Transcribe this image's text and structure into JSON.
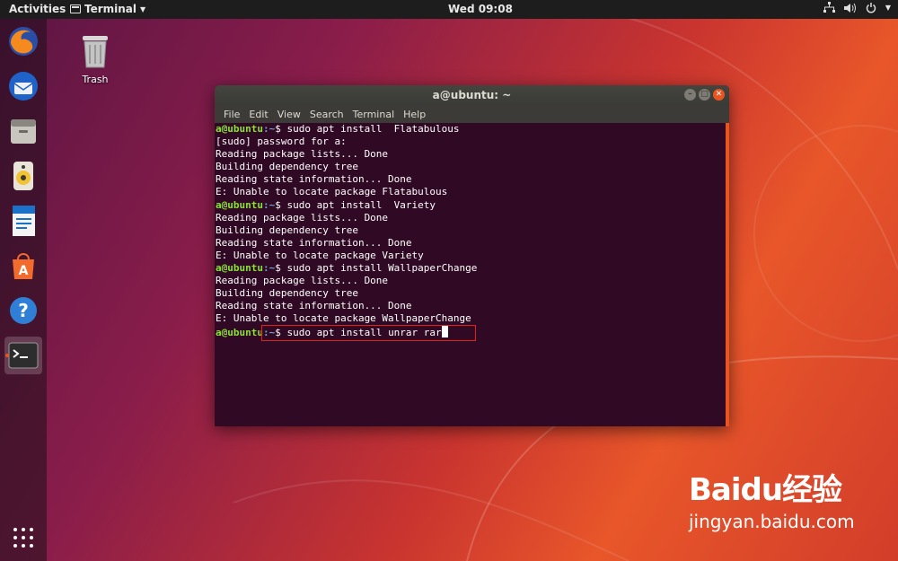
{
  "topbar": {
    "activities": "Activities",
    "app_name": "Terminal",
    "clock": "Wed 09:08"
  },
  "dock": {
    "items": [
      "firefox-icon",
      "thunderbird-icon",
      "files-icon",
      "rhythmbox-icon",
      "writer-icon",
      "software-center-icon",
      "help-icon",
      "terminal-icon"
    ]
  },
  "desktop": {
    "trash_label": "Trash"
  },
  "terminal": {
    "title": "a@ubuntu: ~",
    "menu": [
      "File",
      "Edit",
      "View",
      "Search",
      "Terminal",
      "Help"
    ],
    "prompt_user": "a@ubuntu",
    "prompt_path": ":~",
    "lines": [
      {
        "type": "prompt",
        "cmd": "$ sudo apt install  Flatabulous"
      },
      {
        "type": "out",
        "text": "[sudo] password for a:"
      },
      {
        "type": "out",
        "text": "Reading package lists... Done"
      },
      {
        "type": "out",
        "text": "Building dependency tree"
      },
      {
        "type": "out",
        "text": "Reading state information... Done"
      },
      {
        "type": "out",
        "text": "E: Unable to locate package Flatabulous"
      },
      {
        "type": "prompt",
        "cmd": "$ sudo apt install  Variety"
      },
      {
        "type": "out",
        "text": "Reading package lists... Done"
      },
      {
        "type": "out",
        "text": "Building dependency tree"
      },
      {
        "type": "out",
        "text": "Reading state information... Done"
      },
      {
        "type": "out",
        "text": "E: Unable to locate package Variety"
      },
      {
        "type": "prompt",
        "cmd": "$ sudo apt install WallpaperChange"
      },
      {
        "type": "out",
        "text": "Reading package lists... Done"
      },
      {
        "type": "out",
        "text": "Building dependency tree"
      },
      {
        "type": "out",
        "text": "Reading state information... Done"
      },
      {
        "type": "out",
        "text": "E: Unable to locate package WallpaperChange"
      },
      {
        "type": "prompt",
        "cmd": "$ sudo apt install unrar rar",
        "cursor": true
      }
    ]
  },
  "watermark": {
    "brand": "Baidu经验",
    "site": "jingyan.baidu.com"
  },
  "colors": {
    "accent": "#e95420",
    "terminal_bg": "#300a24",
    "prompt_user": "#8ae234",
    "prompt_path": "#729fcf",
    "annotation_box": "#e4201b"
  }
}
